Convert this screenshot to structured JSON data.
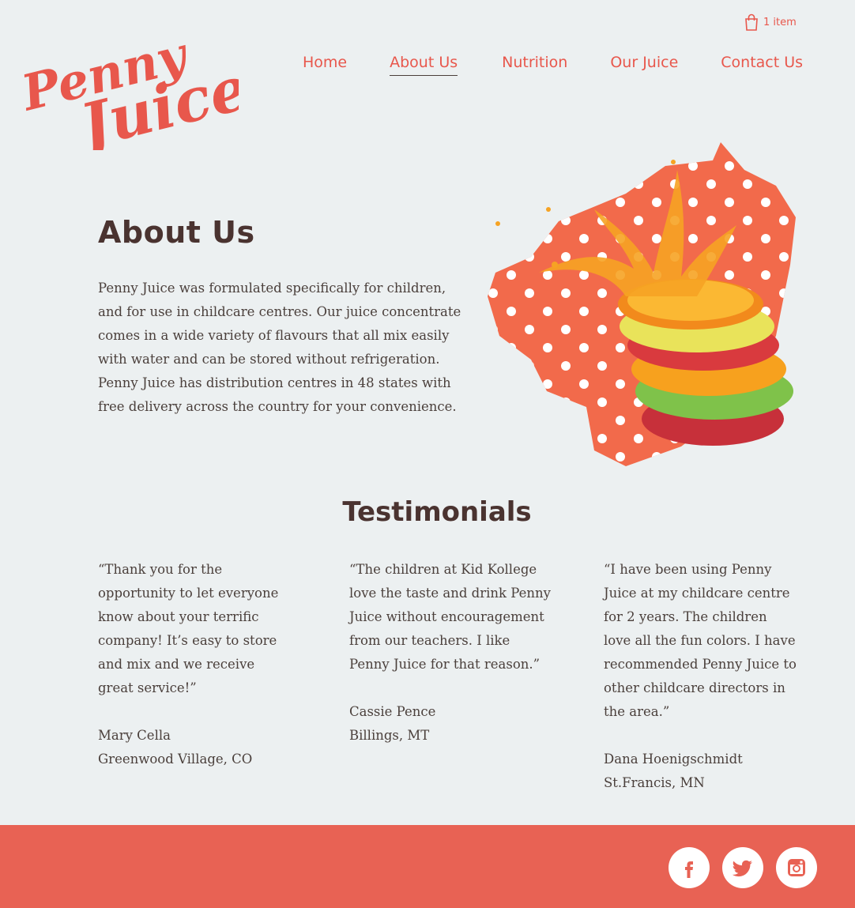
{
  "brand": {
    "logo_line1": "Penny",
    "logo_line2": "Juice",
    "color": "#e8574c"
  },
  "cart": {
    "label": "1 item",
    "icon": "shopping-bag-icon"
  },
  "nav": {
    "items": [
      {
        "label": "Home"
      },
      {
        "label": "About Us",
        "active": true
      },
      {
        "label": "Nutrition"
      },
      {
        "label": "Our Juice"
      },
      {
        "label": "Contact Us"
      }
    ]
  },
  "about": {
    "title": "About Us",
    "text": "Penny Juice was formulated specifically for children, and for use in childcare centres. Our juice concentrate comes in a wide variety of flavours that all mix easily with water and can be stored without refrigeration. Penny Juice has distribution centres in 48 states with free delivery across the country for your convenience."
  },
  "testimonials": {
    "title": "Testimonials",
    "items": [
      {
        "quote": "“Thank you for the opportunity to let everyone know about your terrific company! It’s easy to store and mix and we receive great service!”",
        "name": "Mary Cella",
        "location": "Greenwood Village, CO"
      },
      {
        "quote": "“The children at Kid Kollege love the taste and drink Penny Juice without encouragement from our teachers. I like Penny Juice for that reason.”",
        "name": "Cassie Pence",
        "location": "Billings, MT"
      },
      {
        "quote": "“I have been using Penny Juice at my childcare centre for 2 years. The children love all the fun colors. I have recommended Penny Juice to other childcare directors in the area.”",
        "name": "Dana Hoenigschmidt",
        "location": "St.Francis, MN"
      }
    ]
  },
  "footer": {
    "background": "#e86254",
    "social": [
      "facebook-icon",
      "twitter-icon",
      "instagram-icon"
    ]
  }
}
